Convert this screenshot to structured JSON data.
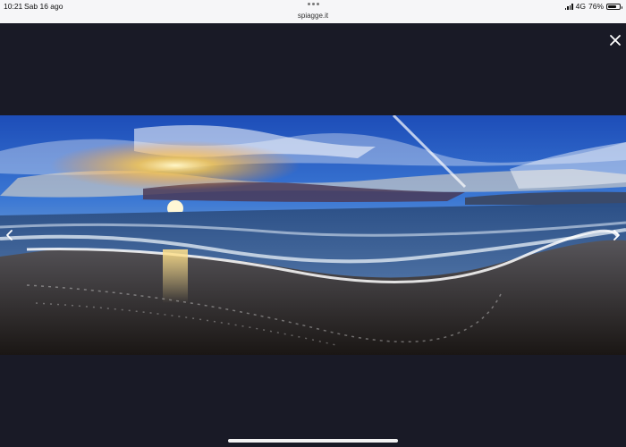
{
  "status_bar": {
    "time": "10:21",
    "date": "Sab 16 ago",
    "url": "spiagge.it",
    "network": "4G",
    "battery_text": "76%",
    "battery_level": 0.76
  },
  "viewer": {
    "background": "#191a26",
    "close_icon": "close-icon",
    "prev_icon": "chevron-left-icon",
    "next_icon": "chevron-right-icon"
  }
}
